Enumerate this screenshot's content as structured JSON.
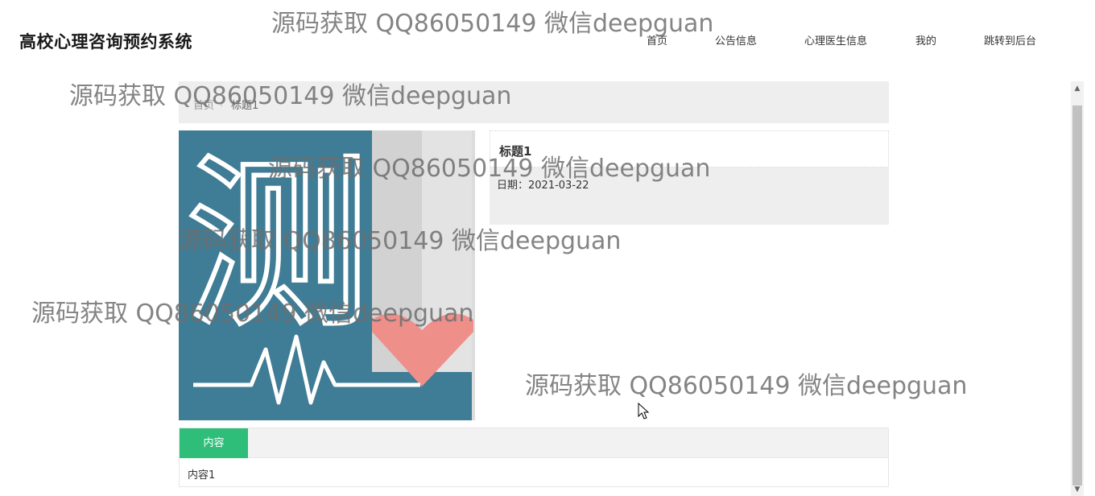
{
  "header": {
    "site_title": "高校心理咨询预约系统",
    "nav": [
      "首页",
      "公告信息",
      "心理医生信息",
      "我的",
      "跳转到后台"
    ]
  },
  "breadcrumb": {
    "home": "首页",
    "separator": "/",
    "current": "标题1"
  },
  "detail": {
    "title": "标题1",
    "date_label": "日期：2021-03-22",
    "image_text": "测"
  },
  "tabs": {
    "active_tab": "内容",
    "content": "内容1"
  },
  "watermarks": [
    "源码获取 QQ86050149 微信deepguan",
    "源码获取 QQ86050149 微信deepguan",
    "源码获取 QQ86050149 微信deepguan",
    "源码获取 QQ86050149 微信deepguan",
    "源码获取 QQ86050149 微信deepguan",
    "源码获取 QQ86050149 微信deepguan"
  ],
  "colors": {
    "accent": "#2fbe7a",
    "image_bg": "#3f7c95",
    "heart": "#ee8f8a"
  }
}
